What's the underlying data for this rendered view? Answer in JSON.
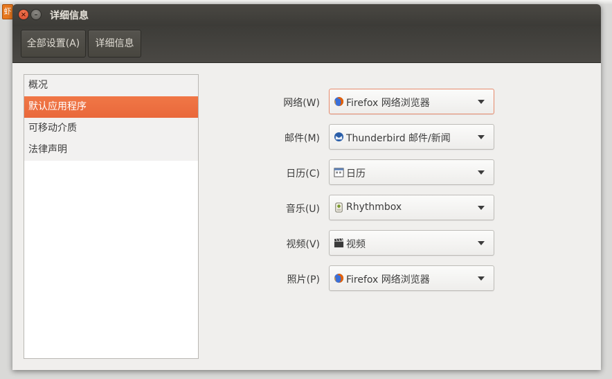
{
  "desktop": {
    "app_icon_glyph": "虾"
  },
  "window": {
    "title": "详细信息"
  },
  "toolbar": {
    "all_settings_label": "全部设置(A)",
    "details_label": "详细信息"
  },
  "sidebar": {
    "items": [
      {
        "label": "概况",
        "selected": false
      },
      {
        "label": "默认应用程序",
        "selected": true
      },
      {
        "label": "可移动介质",
        "selected": false
      },
      {
        "label": "法律声明",
        "selected": false
      }
    ]
  },
  "defaults": [
    {
      "label": "网络(W)",
      "value": "Firefox 网络浏览器",
      "icon": "firefox-icon",
      "focused": true
    },
    {
      "label": "邮件(M)",
      "value": "Thunderbird 邮件/新闻",
      "icon": "thunderbird-icon",
      "focused": false
    },
    {
      "label": "日历(C)",
      "value": "日历",
      "icon": "calendar-icon",
      "focused": false
    },
    {
      "label": "音乐(U)",
      "value": "Rhythmbox",
      "icon": "rhythmbox-icon",
      "focused": false
    },
    {
      "label": "视频(V)",
      "value": "视频",
      "icon": "video-clapper-icon",
      "focused": false
    },
    {
      "label": "照片(P)",
      "value": "Firefox 网络浏览器",
      "icon": "firefox-icon",
      "focused": false
    }
  ],
  "colors": {
    "accent": "#e9683b",
    "titlebar": "#3c3b37",
    "window_bg": "#f0efed"
  }
}
